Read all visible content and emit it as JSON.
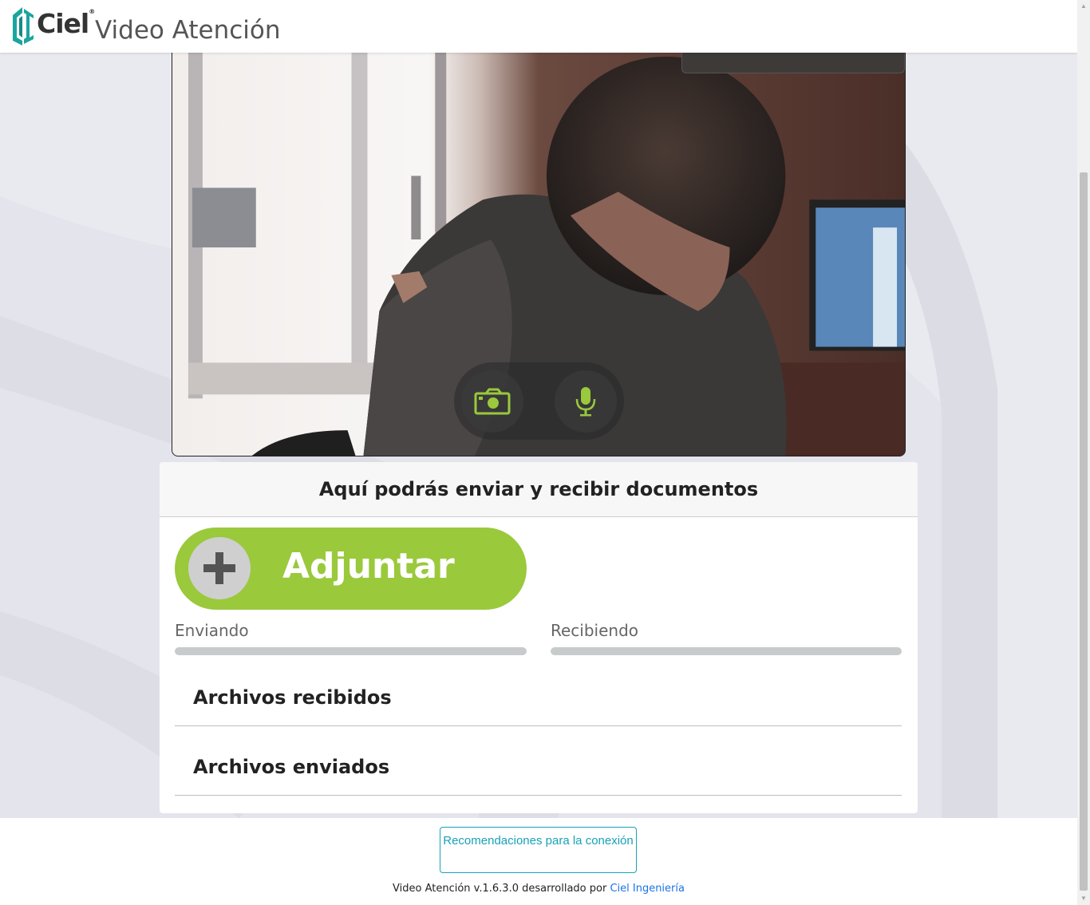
{
  "header": {
    "logo_text": "Ciel",
    "logo_reg": "®",
    "title": "Video Atención"
  },
  "video": {
    "camera_button_icon": "camera-icon",
    "mic_button_icon": "microphone-icon",
    "accent_color": "#9ac93c"
  },
  "documents": {
    "heading": "Aquí podrás enviar y recibir documentos",
    "attach_label": "Adjuntar",
    "sending_label": "Enviando",
    "sending_progress": 0,
    "receiving_label": "Recibiendo",
    "receiving_progress": 0,
    "received_files_title": "Archivos recibidos",
    "sent_files_title": "Archivos enviados"
  },
  "footer": {
    "recommendations_label": "Recomendaciones para la conexión",
    "version_text": "Video Atención v.1.6.3.0 desarrollado por",
    "developer_link": "Ciel Ingeniería"
  },
  "colors": {
    "brand_green": "#9ac93c",
    "link_teal": "#17a2b8",
    "logo_teal": "#1aa5a0"
  }
}
